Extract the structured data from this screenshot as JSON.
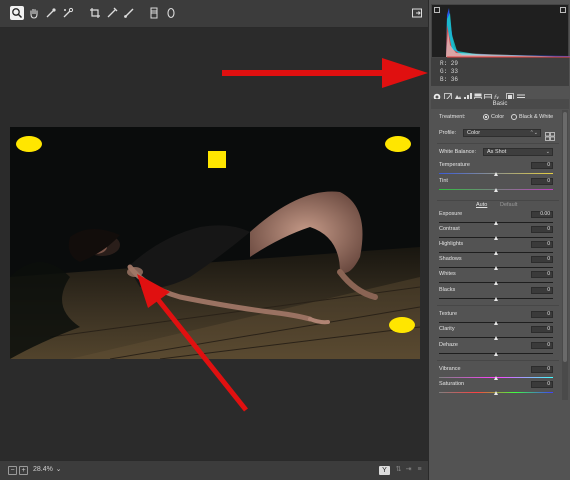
{
  "toolbar": {
    "tools": [
      {
        "name": "zoom-icon",
        "active": true
      },
      {
        "name": "hand-icon"
      },
      {
        "name": "white-balance-icon"
      },
      {
        "name": "color-sampler-icon"
      },
      {
        "name": "crop-icon"
      },
      {
        "name": "spot-removal-icon"
      },
      {
        "name": "adjustment-brush-icon"
      },
      {
        "name": "graduated-filter-icon"
      },
      {
        "name": "radial-filter-icon"
      }
    ],
    "right_icon": "open-preferences-icon"
  },
  "statusbar": {
    "zoom": "28.4%",
    "view_toggle": "Y"
  },
  "histogram": {
    "rgb_readout": {
      "r": "R:  29",
      "g": "G:  33",
      "b": "B:  36"
    }
  },
  "panel": {
    "section_title": "Basic",
    "treatment": {
      "label": "Treatment:",
      "color": "Color",
      "bw": "Black & White",
      "selected": "color"
    },
    "profile": {
      "label": "Profile:",
      "value": "Color"
    },
    "white_balance": {
      "label": "White Balance:",
      "value": "As Shot"
    },
    "auto_label": "Auto",
    "default_label": "Default",
    "sliders": [
      {
        "key": "temperature",
        "label": "Temperature",
        "value": "0",
        "position": 0.5
      },
      {
        "key": "tint",
        "label": "Tint",
        "value": "0",
        "position": 0.5
      },
      {
        "key": "exposure",
        "label": "Exposure",
        "value": "0.00",
        "position": 0.5
      },
      {
        "key": "contrast",
        "label": "Contrast",
        "value": "0",
        "position": 0.5
      },
      {
        "key": "highlights",
        "label": "Highlights",
        "value": "0",
        "position": 0.5
      },
      {
        "key": "shadows",
        "label": "Shadows",
        "value": "0",
        "position": 0.5
      },
      {
        "key": "whites",
        "label": "Whites",
        "value": "0",
        "position": 0.5
      },
      {
        "key": "blacks",
        "label": "Blacks",
        "value": "0",
        "position": 0.5
      },
      {
        "key": "texture",
        "label": "Texture",
        "value": "0",
        "position": 0.5
      },
      {
        "key": "clarity",
        "label": "Clarity",
        "value": "0",
        "position": 0.5
      },
      {
        "key": "dehaze",
        "label": "Dehaze",
        "value": "0",
        "position": 0.5
      },
      {
        "key": "vibrance",
        "label": "Vibrance",
        "value": "0",
        "position": 0.5
      },
      {
        "key": "saturation",
        "label": "Saturation",
        "value": "0",
        "position": 0.5
      }
    ]
  },
  "colors": {
    "annotation_arrow": "#e01010",
    "annotation_marker": "#ffe600",
    "panel_bg": "#535353",
    "canvas_bg": "#2b2b2b"
  }
}
